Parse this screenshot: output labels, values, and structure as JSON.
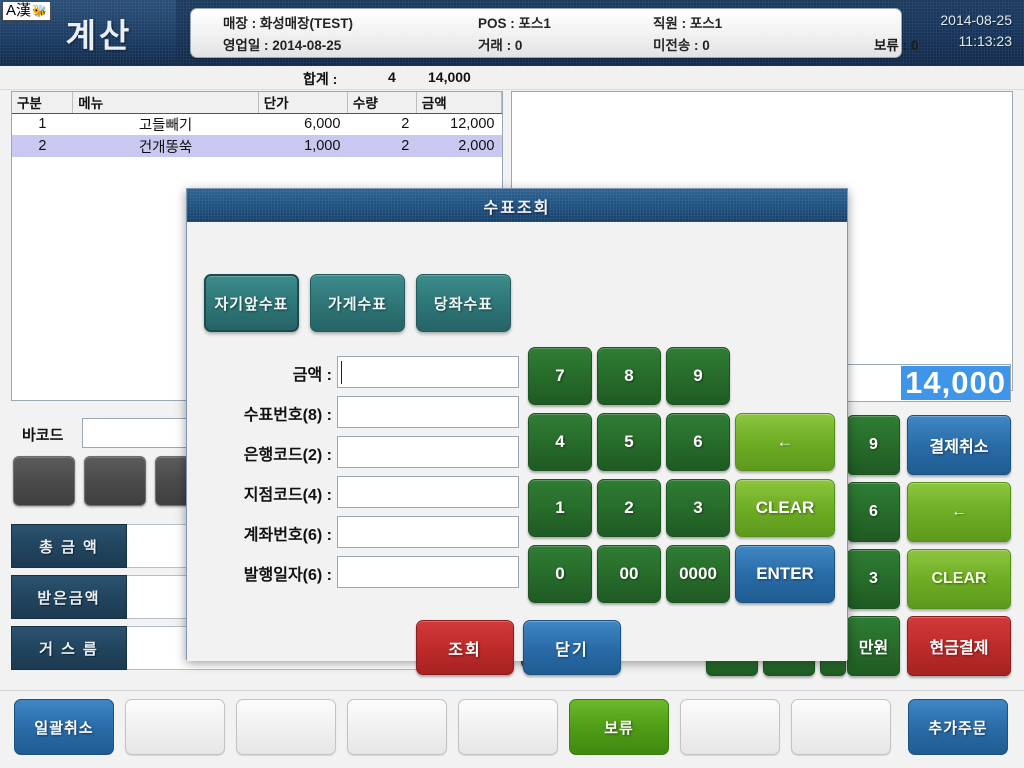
{
  "header": {
    "ime_indicator": "A漢",
    "page_title": "계산",
    "store_label": "매장 : 화성매장(TEST)",
    "pos_label": "POS : 포스1",
    "staff_label": "직원 : 포스1",
    "bizdate_label": "영업일 : 2014-08-25",
    "deal_label": "거래 : 0",
    "untransmitted_label": "미전송 : 0",
    "hold_label": "보류 : 0",
    "date": "2014-08-25",
    "time": "11:13:23"
  },
  "summary": {
    "total_label": "합계 :",
    "total_qty": "4",
    "total_amount": "14,000"
  },
  "order_table": {
    "columns": [
      "구분",
      "메뉴",
      "단가",
      "수량",
      "금액"
    ],
    "rows": [
      {
        "gubun": "1",
        "menu": "고들빼기",
        "price": "6,000",
        "qty": "2",
        "amount": "12,000",
        "selected": false
      },
      {
        "gubun": "2",
        "menu": "건개똥쑥",
        "price": "1,000",
        "qty": "2",
        "amount": "2,000",
        "selected": true
      }
    ]
  },
  "barcode": {
    "label": "바코드",
    "value": "",
    "placeholder": ""
  },
  "gray_buttons": [
    "",
    "",
    ""
  ],
  "totals": [
    {
      "label": "총 금 액",
      "value": ""
    },
    {
      "label": "받은금액",
      "value": ""
    },
    {
      "label": "거 스 름",
      "value": ""
    }
  ],
  "amount_display": {
    "value": "14,000"
  },
  "right_keypad": {
    "digits_col": [
      "9",
      "6",
      "3",
      "만원"
    ],
    "actions": [
      {
        "label": "결제취소",
        "color": "#2a6ca8"
      },
      {
        "label": "←",
        "color": "#6fae25"
      },
      {
        "label": "CLEAR",
        "color": "#6fae25"
      },
      {
        "label": "현금결제",
        "color": "#bf2b2b"
      }
    ]
  },
  "bottom_bar": [
    {
      "label": "일괄취소",
      "style": "blue"
    },
    {
      "label": "",
      "style": "empty"
    },
    {
      "label": "",
      "style": "empty"
    },
    {
      "label": "",
      "style": "empty"
    },
    {
      "label": "",
      "style": "empty"
    },
    {
      "label": "",
      "style": "empty"
    },
    {
      "label": "보류",
      "style": "green"
    },
    {
      "label": "",
      "style": "empty"
    },
    {
      "label": "",
      "style": "empty"
    },
    {
      "label": "추가주문",
      "style": "blue"
    }
  ],
  "dialog": {
    "title": "수표조회",
    "tabs": [
      {
        "label": "자기앞수표",
        "active": true
      },
      {
        "label": "가게수표",
        "active": false
      },
      {
        "label": "당좌수표",
        "active": false
      }
    ],
    "fields": [
      {
        "label": "금액 :",
        "value": "",
        "focused": true
      },
      {
        "label": "수표번호(8) :",
        "value": "",
        "focused": false
      },
      {
        "label": "은행코드(2) :",
        "value": "",
        "focused": false
      },
      {
        "label": "지점코드(4) :",
        "value": "",
        "focused": false
      },
      {
        "label": "계좌번호(6) :",
        "value": "",
        "focused": false
      },
      {
        "label": "발행일자(6) :",
        "value": "",
        "focused": false
      }
    ],
    "numpad": [
      {
        "label": "7",
        "kind": "green"
      },
      {
        "label": "8",
        "kind": "green"
      },
      {
        "label": "9",
        "kind": "green"
      },
      {
        "label": "4",
        "kind": "green"
      },
      {
        "label": "5",
        "kind": "green"
      },
      {
        "label": "6",
        "kind": "green"
      },
      {
        "label": "←",
        "kind": "lime"
      },
      {
        "label": "1",
        "kind": "green"
      },
      {
        "label": "2",
        "kind": "green"
      },
      {
        "label": "3",
        "kind": "green"
      },
      {
        "label": "CLEAR",
        "kind": "lime"
      },
      {
        "label": "0",
        "kind": "green"
      },
      {
        "label": "00",
        "kind": "green"
      },
      {
        "label": "0000",
        "kind": "green"
      },
      {
        "label": "ENTER",
        "kind": "blue"
      }
    ],
    "actions": [
      {
        "label": "조회",
        "kind": "red"
      },
      {
        "label": "닫기",
        "kind": "blue"
      }
    ]
  },
  "colors": {
    "header_blue": "#17355a",
    "dialog_title_blue": "#215484",
    "accent_highlight": "#3f96e8",
    "keypad_green": "#276c2b",
    "keypad_lime": "#6fae25",
    "keypad_blue": "#2a6ca8",
    "keypad_red": "#bf2b2b",
    "tab_teal": "#2f7778",
    "selected_row": "#c8c8f0"
  }
}
